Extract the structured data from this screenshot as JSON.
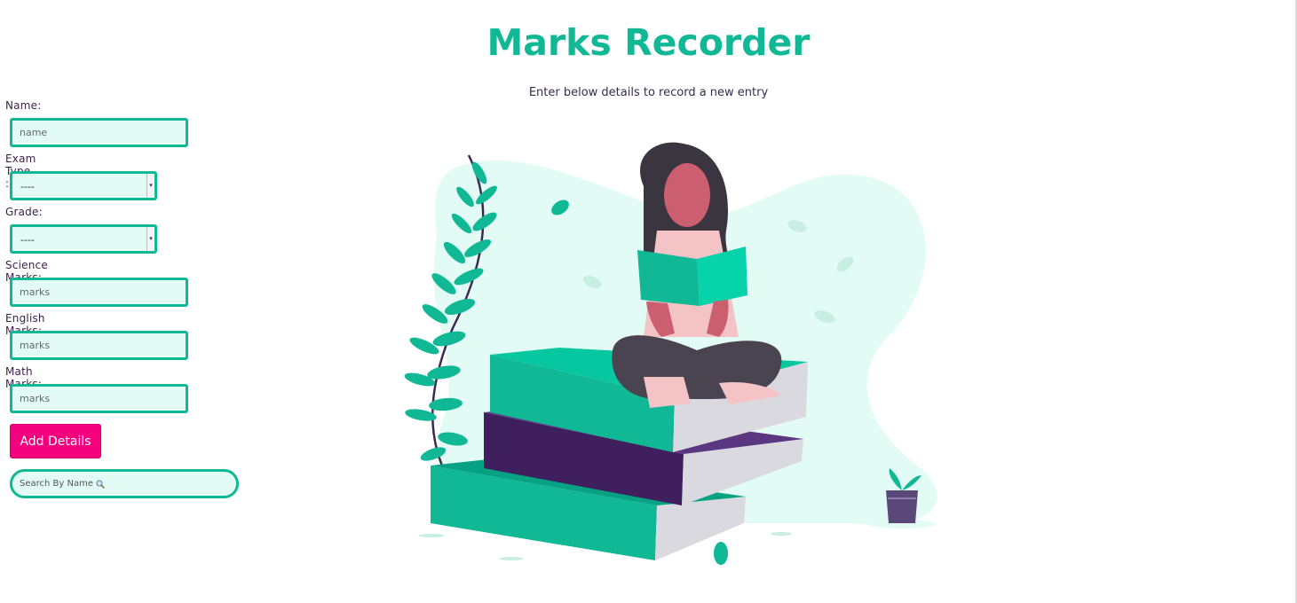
{
  "header": {
    "title": "Marks Recorder",
    "subtitle": "Enter below details to record a new entry"
  },
  "form": {
    "name": {
      "label": "Name:",
      "placeholder": "name"
    },
    "exam_type": {
      "label": "Exam Type :",
      "selected": "----"
    },
    "grade": {
      "label": "Grade:",
      "selected": "----"
    },
    "science": {
      "label": "Science Marks:",
      "placeholder": "marks"
    },
    "english": {
      "label": "English Marks:",
      "placeholder": "marks"
    },
    "math": {
      "label": "Math Marks:",
      "placeholder": "marks"
    },
    "submit_label": "Add Details",
    "search": {
      "placeholder": "Search By Name",
      "icon": "magnifier-icon"
    }
  },
  "colors": {
    "accent": "#10b895",
    "button": "#f4007f",
    "input_bg": "#e2fbf5",
    "text": "#3b1f4a"
  },
  "illustration": {
    "subject": "woman-reading-on-books-illustration"
  }
}
